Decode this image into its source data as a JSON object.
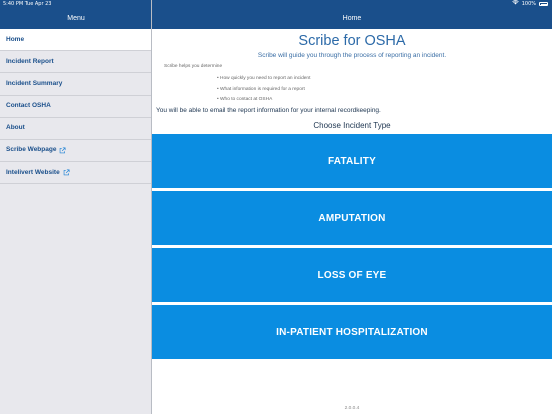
{
  "status_bar": {
    "time_date": "5:40 PM  Tue Apr 23",
    "battery": "100%",
    "wifi_icon": "wifi-icon",
    "battery_icon": "battery-icon"
  },
  "menu": {
    "title": "Menu",
    "items": [
      {
        "label": "Home",
        "active": true
      },
      {
        "label": "Incident Report",
        "active": false
      },
      {
        "label": "Incident Summary",
        "active": false
      },
      {
        "label": "Contact OSHA",
        "active": false
      },
      {
        "label": "About",
        "active": false
      },
      {
        "label": "Scribe Webpage",
        "active": false,
        "icon": "external-link-icon"
      },
      {
        "label": "Intelivert Website",
        "active": false,
        "icon": "external-link-icon"
      }
    ]
  },
  "home": {
    "nav_title": "Home",
    "title": "Scribe for OSHA",
    "intro": "Scribe will guide you through the process of reporting an incident.",
    "helps_heading": "Scribe helps you determine",
    "bullets": [
      "• How quickly you need to report an incident",
      "• What information is required for a report",
      "• Who to contact at OSHA"
    ],
    "email_note": "You will be able to email the report information for your internal recordkeeping.",
    "choose_label": "Choose Incident Type",
    "incident_types": [
      "FATALITY",
      "AMPUTATION",
      "LOSS OF EYE",
      "IN-PATIENT HOSPITALIZATION"
    ],
    "version": "2.0.0.4"
  },
  "colors": {
    "nav_bar": "#1a4f8b",
    "menu_text": "#1a4f8b",
    "button_bg": "#0a8de1",
    "sidebar_bg": "#e8e8ed",
    "title_text": "#2c6aa8"
  }
}
